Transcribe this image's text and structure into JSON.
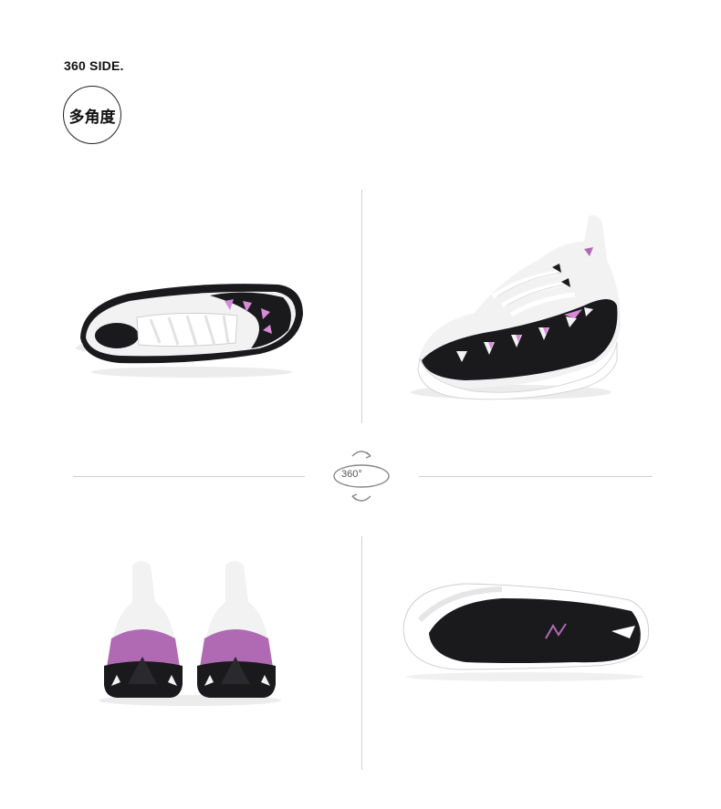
{
  "header": {
    "title": "360 SIDE.",
    "badge": "多角度"
  },
  "divider": {
    "rotate_label": "360°",
    "rotate_icon": "rotate-360-icon"
  },
  "colors": {
    "upper": "#f2f2f3",
    "black": "#1a1a1d",
    "purple": "#b06ab3",
    "pink": "#d88ad9",
    "sole": "#ffffff",
    "line": "#cfcfcf"
  },
  "views": [
    {
      "id": "top-view"
    },
    {
      "id": "side-view"
    },
    {
      "id": "back-view"
    },
    {
      "id": "outsole-view"
    }
  ]
}
